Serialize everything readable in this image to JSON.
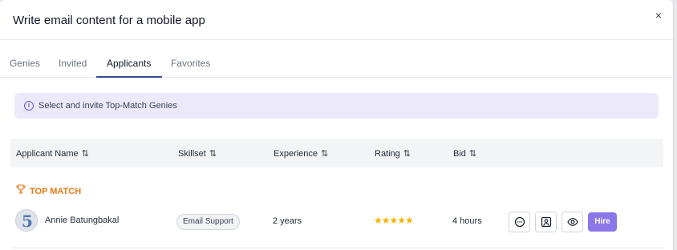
{
  "modal": {
    "title": "Write email content for a mobile app",
    "close_glyph": "×"
  },
  "tabs": [
    {
      "label": "Genies"
    },
    {
      "label": "Invited"
    },
    {
      "label": "Applicants",
      "active": true
    },
    {
      "label": "Favorites"
    }
  ],
  "banner": {
    "text": "Select and invite Top-Match Genies",
    "icon": "info-icon"
  },
  "table": {
    "columns": [
      "Applicant Name",
      "Skillset",
      "Experience",
      "Rating",
      "Bid"
    ],
    "sort_glyph": "⇅",
    "group_label": "TOP MATCH",
    "rows": [
      {
        "name": "Annie Batungbakal",
        "avatar_text": "5",
        "skill": "Email Support",
        "experience": "2 years",
        "rating": 5,
        "stars": "★★★★★",
        "bid": "4 hours",
        "actions": [
          "message-icon",
          "profile-icon",
          "eye-icon"
        ],
        "hire_label": "Hire"
      }
    ]
  },
  "colors": {
    "accent": "#8b77e8",
    "top_match": "#ea7a16",
    "star": "#f5b301",
    "banner_bg": "#ece9fb"
  }
}
